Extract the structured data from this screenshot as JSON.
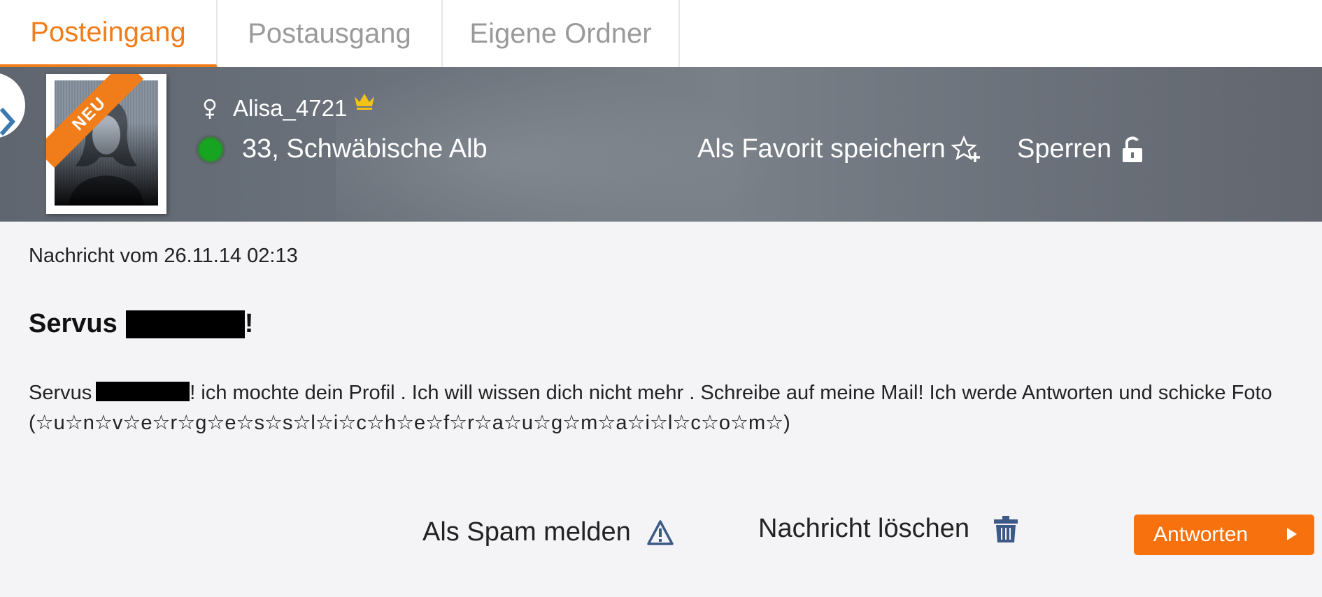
{
  "tabs": [
    {
      "label": "Posteingang",
      "active": true
    },
    {
      "label": "Postausgang",
      "active": false
    },
    {
      "label": "Eigene Ordner",
      "active": false
    }
  ],
  "profile": {
    "badge": "NEU",
    "username": "Alisa_4721",
    "gender_icon": "female-symbol-icon",
    "premium_icon": "crown-icon",
    "online_status": "online",
    "age_location": "33, Schwäbische Alb",
    "favorite_label": "Als Favorit speichern",
    "block_label": "Sperren"
  },
  "message": {
    "date": "Nachricht vom 26.11.14 02:13",
    "subject_prefix": "Servus",
    "subject_suffix": "!",
    "body_prefix": "Servus",
    "body_text": "! ich mochte dein Profil . Ich will wissen dich nicht mehr . Schreibe auf meine Mail! Ich werde Antworten und schicke Foto (☆u☆n☆v☆e☆r☆g☆e☆s☆s☆l☆i☆c☆h☆e☆f☆r☆a☆u☆g☆m☆a☆i☆l☆c☆o☆m☆)"
  },
  "actions": {
    "spam_label": "Als Spam melden",
    "delete_label": "Nachricht löschen",
    "reply_label": "Antworten"
  },
  "colors": {
    "accent": "#f07d19",
    "reply_button": "#f7720f",
    "online": "#16a421",
    "action_icon": "#3d5a87"
  }
}
